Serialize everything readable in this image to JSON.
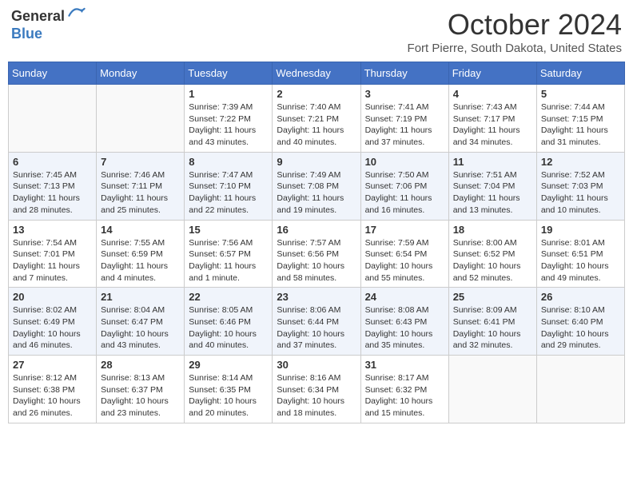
{
  "header": {
    "logo_general": "General",
    "logo_blue": "Blue",
    "month_title": "October 2024",
    "location": "Fort Pierre, South Dakota, United States"
  },
  "days_of_week": [
    "Sunday",
    "Monday",
    "Tuesday",
    "Wednesday",
    "Thursday",
    "Friday",
    "Saturday"
  ],
  "weeks": [
    [
      {
        "day": "",
        "info": ""
      },
      {
        "day": "",
        "info": ""
      },
      {
        "day": "1",
        "sunrise": "Sunrise: 7:39 AM",
        "sunset": "Sunset: 7:22 PM",
        "daylight": "Daylight: 11 hours and 43 minutes."
      },
      {
        "day": "2",
        "sunrise": "Sunrise: 7:40 AM",
        "sunset": "Sunset: 7:21 PM",
        "daylight": "Daylight: 11 hours and 40 minutes."
      },
      {
        "day": "3",
        "sunrise": "Sunrise: 7:41 AM",
        "sunset": "Sunset: 7:19 PM",
        "daylight": "Daylight: 11 hours and 37 minutes."
      },
      {
        "day": "4",
        "sunrise": "Sunrise: 7:43 AM",
        "sunset": "Sunset: 7:17 PM",
        "daylight": "Daylight: 11 hours and 34 minutes."
      },
      {
        "day": "5",
        "sunrise": "Sunrise: 7:44 AM",
        "sunset": "Sunset: 7:15 PM",
        "daylight": "Daylight: 11 hours and 31 minutes."
      }
    ],
    [
      {
        "day": "6",
        "sunrise": "Sunrise: 7:45 AM",
        "sunset": "Sunset: 7:13 PM",
        "daylight": "Daylight: 11 hours and 28 minutes."
      },
      {
        "day": "7",
        "sunrise": "Sunrise: 7:46 AM",
        "sunset": "Sunset: 7:11 PM",
        "daylight": "Daylight: 11 hours and 25 minutes."
      },
      {
        "day": "8",
        "sunrise": "Sunrise: 7:47 AM",
        "sunset": "Sunset: 7:10 PM",
        "daylight": "Daylight: 11 hours and 22 minutes."
      },
      {
        "day": "9",
        "sunrise": "Sunrise: 7:49 AM",
        "sunset": "Sunset: 7:08 PM",
        "daylight": "Daylight: 11 hours and 19 minutes."
      },
      {
        "day": "10",
        "sunrise": "Sunrise: 7:50 AM",
        "sunset": "Sunset: 7:06 PM",
        "daylight": "Daylight: 11 hours and 16 minutes."
      },
      {
        "day": "11",
        "sunrise": "Sunrise: 7:51 AM",
        "sunset": "Sunset: 7:04 PM",
        "daylight": "Daylight: 11 hours and 13 minutes."
      },
      {
        "day": "12",
        "sunrise": "Sunrise: 7:52 AM",
        "sunset": "Sunset: 7:03 PM",
        "daylight": "Daylight: 11 hours and 10 minutes."
      }
    ],
    [
      {
        "day": "13",
        "sunrise": "Sunrise: 7:54 AM",
        "sunset": "Sunset: 7:01 PM",
        "daylight": "Daylight: 11 hours and 7 minutes."
      },
      {
        "day": "14",
        "sunrise": "Sunrise: 7:55 AM",
        "sunset": "Sunset: 6:59 PM",
        "daylight": "Daylight: 11 hours and 4 minutes."
      },
      {
        "day": "15",
        "sunrise": "Sunrise: 7:56 AM",
        "sunset": "Sunset: 6:57 PM",
        "daylight": "Daylight: 11 hours and 1 minute."
      },
      {
        "day": "16",
        "sunrise": "Sunrise: 7:57 AM",
        "sunset": "Sunset: 6:56 PM",
        "daylight": "Daylight: 10 hours and 58 minutes."
      },
      {
        "day": "17",
        "sunrise": "Sunrise: 7:59 AM",
        "sunset": "Sunset: 6:54 PM",
        "daylight": "Daylight: 10 hours and 55 minutes."
      },
      {
        "day": "18",
        "sunrise": "Sunrise: 8:00 AM",
        "sunset": "Sunset: 6:52 PM",
        "daylight": "Daylight: 10 hours and 52 minutes."
      },
      {
        "day": "19",
        "sunrise": "Sunrise: 8:01 AM",
        "sunset": "Sunset: 6:51 PM",
        "daylight": "Daylight: 10 hours and 49 minutes."
      }
    ],
    [
      {
        "day": "20",
        "sunrise": "Sunrise: 8:02 AM",
        "sunset": "Sunset: 6:49 PM",
        "daylight": "Daylight: 10 hours and 46 minutes."
      },
      {
        "day": "21",
        "sunrise": "Sunrise: 8:04 AM",
        "sunset": "Sunset: 6:47 PM",
        "daylight": "Daylight: 10 hours and 43 minutes."
      },
      {
        "day": "22",
        "sunrise": "Sunrise: 8:05 AM",
        "sunset": "Sunset: 6:46 PM",
        "daylight": "Daylight: 10 hours and 40 minutes."
      },
      {
        "day": "23",
        "sunrise": "Sunrise: 8:06 AM",
        "sunset": "Sunset: 6:44 PM",
        "daylight": "Daylight: 10 hours and 37 minutes."
      },
      {
        "day": "24",
        "sunrise": "Sunrise: 8:08 AM",
        "sunset": "Sunset: 6:43 PM",
        "daylight": "Daylight: 10 hours and 35 minutes."
      },
      {
        "day": "25",
        "sunrise": "Sunrise: 8:09 AM",
        "sunset": "Sunset: 6:41 PM",
        "daylight": "Daylight: 10 hours and 32 minutes."
      },
      {
        "day": "26",
        "sunrise": "Sunrise: 8:10 AM",
        "sunset": "Sunset: 6:40 PM",
        "daylight": "Daylight: 10 hours and 29 minutes."
      }
    ],
    [
      {
        "day": "27",
        "sunrise": "Sunrise: 8:12 AM",
        "sunset": "Sunset: 6:38 PM",
        "daylight": "Daylight: 10 hours and 26 minutes."
      },
      {
        "day": "28",
        "sunrise": "Sunrise: 8:13 AM",
        "sunset": "Sunset: 6:37 PM",
        "daylight": "Daylight: 10 hours and 23 minutes."
      },
      {
        "day": "29",
        "sunrise": "Sunrise: 8:14 AM",
        "sunset": "Sunset: 6:35 PM",
        "daylight": "Daylight: 10 hours and 20 minutes."
      },
      {
        "day": "30",
        "sunrise": "Sunrise: 8:16 AM",
        "sunset": "Sunset: 6:34 PM",
        "daylight": "Daylight: 10 hours and 18 minutes."
      },
      {
        "day": "31",
        "sunrise": "Sunrise: 8:17 AM",
        "sunset": "Sunset: 6:32 PM",
        "daylight": "Daylight: 10 hours and 15 minutes."
      },
      {
        "day": "",
        "info": ""
      },
      {
        "day": "",
        "info": ""
      }
    ]
  ]
}
